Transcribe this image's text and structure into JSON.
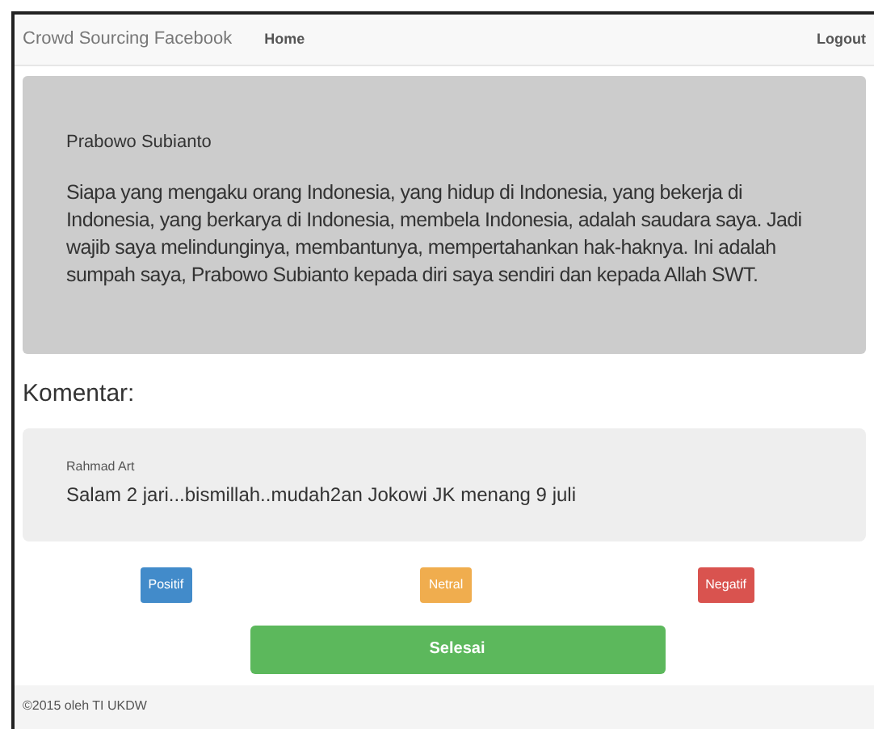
{
  "navbar": {
    "brand": "Crowd Sourcing Facebook",
    "links": [
      "Home"
    ],
    "right_link": "Logout"
  },
  "post": {
    "author": "Prabowo Subianto",
    "text": "Siapa yang mengaku orang Indonesia, yang hidup di Indonesia, yang bekerja di Indonesia, yang berkarya di Indonesia, membela Indonesia, adalah saudara saya. Jadi wajib saya melindunginya, membantunya, mempertahankan hak-haknya. Ini adalah sumpah saya, Prabowo Subianto kepada diri saya sendiri dan kepada Allah SWT."
  },
  "comments_heading": "Komentar:",
  "comment": {
    "author": "Rahmad Art",
    "text": "Salam 2 jari...bismillah..mudah2an Jokowi JK menang 9 juli"
  },
  "sentiment_buttons": [
    {
      "label": "Positif",
      "color": "#428bca"
    },
    {
      "label": "Netral",
      "color": "#f0ad4e"
    },
    {
      "label": "Negatif",
      "color": "#d9534f"
    }
  ],
  "done_button": "Selesai",
  "footer": "©2015 oleh TI UKDW"
}
